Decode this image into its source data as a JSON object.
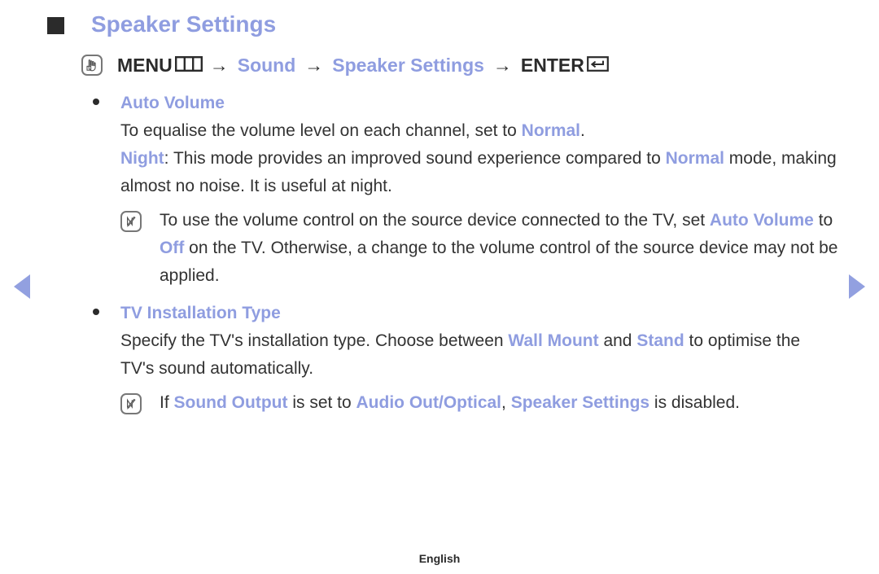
{
  "document": {
    "title": "Speaker Settings",
    "language_footer": "English"
  },
  "navigation": {
    "prev_arrow": "previous-page",
    "next_arrow": "next-page"
  },
  "path": {
    "icon": "hand-pointer-icon",
    "menu_label": "MENU",
    "menu_glyph": "menu-grid-icon",
    "arrow": "→",
    "sound_label": "Sound",
    "speaker_settings_label": "Speaker Settings",
    "enter_label": "ENTER",
    "enter_glyph": "return-key-icon"
  },
  "sections": [
    {
      "label": "Auto Volume",
      "paragraphs": [
        {
          "parts": [
            {
              "t": "To equalise the volume level on each channel, set to ",
              "s": "normal"
            },
            {
              "t": "Normal",
              "s": "hl-b"
            },
            {
              "t": ".",
              "s": "normal"
            }
          ]
        },
        {
          "parts": [
            {
              "t": "Night",
              "s": "hl-b"
            },
            {
              "t": ": This mode provides an improved sound experience compared to ",
              "s": "normal"
            },
            {
              "t": "Normal",
              "s": "hl-b"
            },
            {
              "t": " mode, making almost no noise. It is useful at night.",
              "s": "normal"
            }
          ]
        }
      ],
      "notes": [
        {
          "icon": "note-badge-icon",
          "parts": [
            {
              "t": "To use the volume control on the source device connected to the TV, set ",
              "s": "normal"
            },
            {
              "t": "Auto Volume",
              "s": "hl-b"
            },
            {
              "t": " to ",
              "s": "normal"
            },
            {
              "t": "Off",
              "s": "hl-b"
            },
            {
              "t": " on the TV. Otherwise, a change to the volume control of the source device may not be applied.",
              "s": "normal"
            }
          ]
        }
      ]
    },
    {
      "label": "TV Installation Type",
      "paragraphs": [
        {
          "parts": [
            {
              "t": "Specify the TV's installation type. Choose between ",
              "s": "normal"
            },
            {
              "t": "Wall Mount",
              "s": "hl-b"
            },
            {
              "t": " and ",
              "s": "normal"
            },
            {
              "t": "Stand",
              "s": "hl-b"
            },
            {
              "t": " to optimise the TV's sound automatically.",
              "s": "normal"
            }
          ]
        }
      ],
      "notes": [
        {
          "icon": "note-badge-icon",
          "parts": [
            {
              "t": "If ",
              "s": "normal"
            },
            {
              "t": "Sound Output",
              "s": "hl-b"
            },
            {
              "t": " is set to ",
              "s": "normal"
            },
            {
              "t": "Audio Out/Optical",
              "s": "hl-b"
            },
            {
              "t": ", ",
              "s": "normal"
            },
            {
              "t": "Speaker Settings",
              "s": "hl-b"
            },
            {
              "t": " is disabled.",
              "s": "normal"
            }
          ]
        }
      ]
    }
  ],
  "colors": {
    "accent_blue": "#8f9de0",
    "text_dark": "#333333",
    "bullet_dark": "#2b2b2b"
  }
}
